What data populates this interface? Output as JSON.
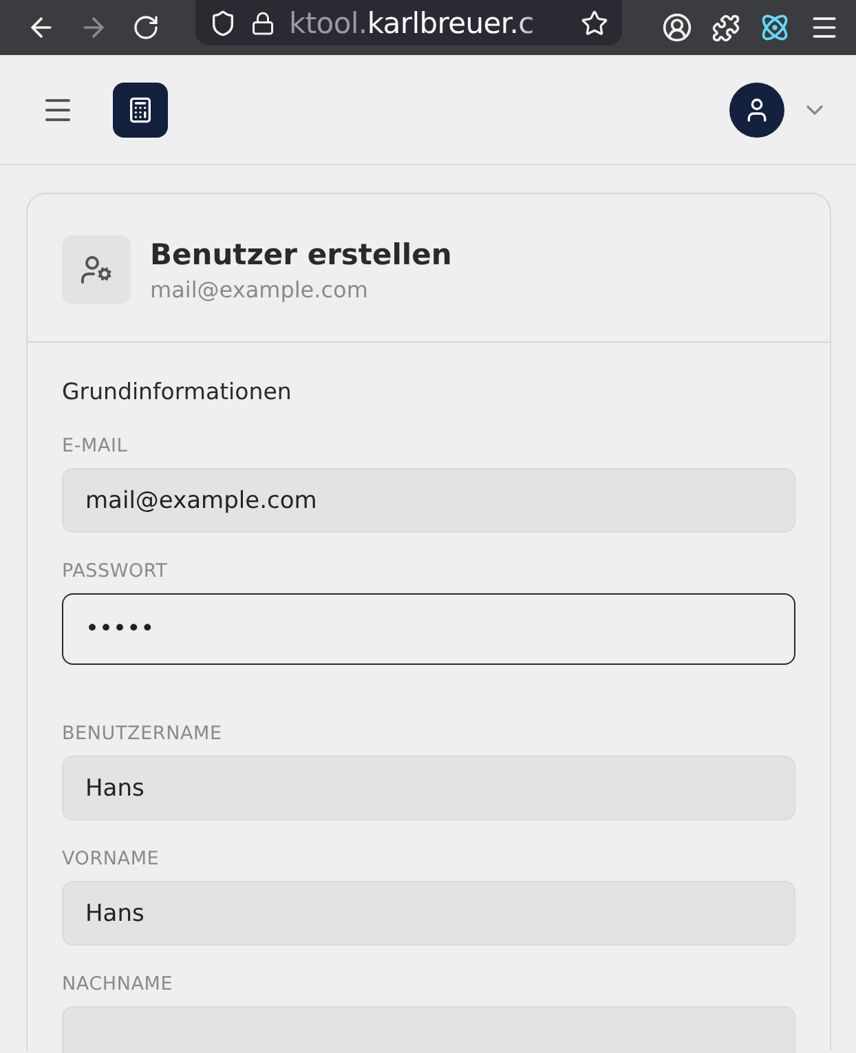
{
  "browser": {
    "url_subdomain": "ktool.",
    "url_domain": "karlbreuer.c"
  },
  "header": {
    "menu_expanded": false
  },
  "card": {
    "title": "Benutzer erstellen",
    "subtitle": "mail@example.com",
    "section_title": "Grundinformationen",
    "fields": [
      {
        "label": "E-MAIL",
        "value": "mail@example.com",
        "focused": false
      },
      {
        "label": "PASSWORT",
        "value": "•••••",
        "focused": true
      },
      {
        "label": "BENUTZERNAME",
        "value": "Hans",
        "focused": false
      },
      {
        "label": "VORNAME",
        "value": "Hans",
        "focused": false
      },
      {
        "label": "NACHNAME",
        "focused": false
      }
    ]
  }
}
